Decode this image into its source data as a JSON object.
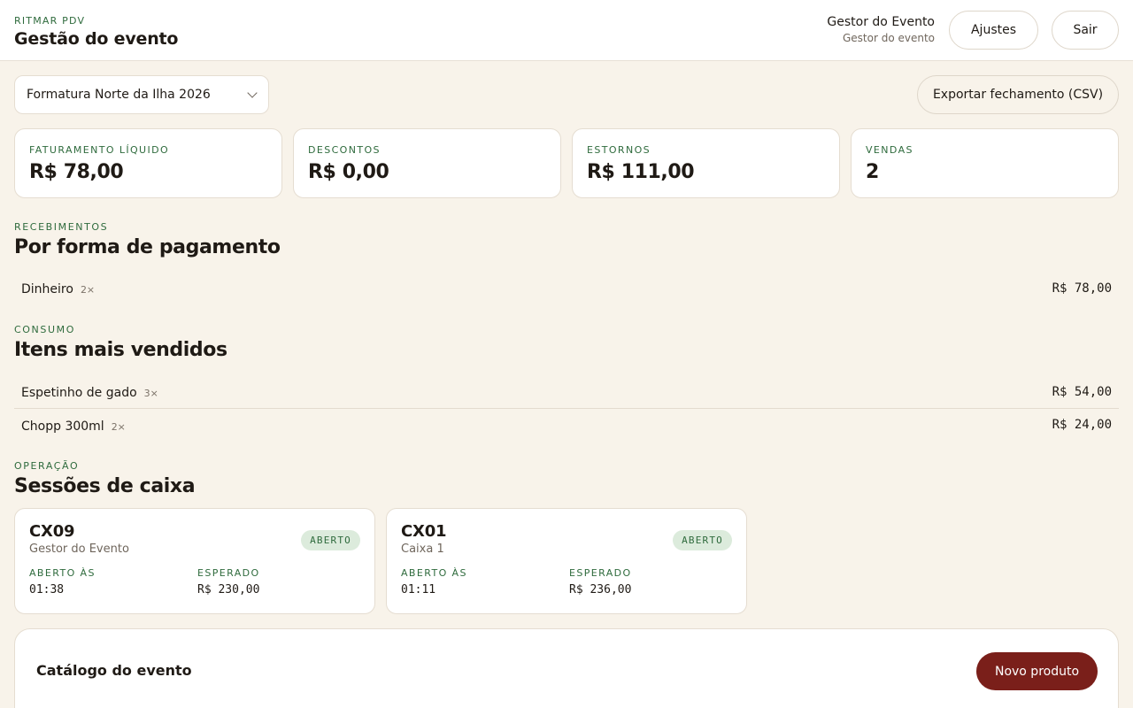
{
  "header": {
    "brand": "RITMAR PDV",
    "title": "Gestão do evento",
    "user_name": "Gestor do Evento",
    "user_role": "Gestor do evento",
    "settings_label": "Ajustes",
    "logout_label": "Sair"
  },
  "toolbar": {
    "event_selected": "Formatura Norte da Ilha 2026",
    "export_label": "Exportar fechamento (CSV)"
  },
  "kpis": [
    {
      "label": "FATURAMENTO LÍQUIDO",
      "value": "R$ 78,00"
    },
    {
      "label": "DESCONTOS",
      "value": "R$ 0,00"
    },
    {
      "label": "ESTORNOS",
      "value": "R$ 111,00"
    },
    {
      "label": "VENDAS",
      "value": "2"
    }
  ],
  "payments": {
    "eyebrow": "RECEBIMENTOS",
    "title": "Por forma de pagamento",
    "rows": [
      {
        "name": "Dinheiro",
        "qty": "2×",
        "amount": "R$ 78,00"
      }
    ]
  },
  "top_items": {
    "eyebrow": "CONSUMO",
    "title": "Itens mais vendidos",
    "rows": [
      {
        "name": "Espetinho de gado",
        "qty": "3×",
        "amount": "R$ 54,00"
      },
      {
        "name": "Chopp 300ml",
        "qty": "2×",
        "amount": "R$ 24,00"
      }
    ]
  },
  "sessions": {
    "eyebrow": "OPERAÇÃO",
    "title": "Sessões de caixa",
    "opened_label": "ABERTO ÀS",
    "expected_label": "ESPERADO",
    "items": [
      {
        "code": "CX09",
        "operator": "Gestor do Evento",
        "status": "ABERTO",
        "opened_at": "01:38",
        "expected": "R$ 230,00"
      },
      {
        "code": "CX01",
        "operator": "Caixa 1",
        "status": "ABERTO",
        "opened_at": "01:11",
        "expected": "R$ 236,00"
      }
    ]
  },
  "catalog": {
    "title": "Catálogo do evento",
    "new_product_label": "Novo produto"
  },
  "colors": {
    "background": "#f8f3ea",
    "accent_green": "#2f6b3d",
    "badge_bg": "#dcebdc",
    "primary_button": "#7a1f1a"
  }
}
